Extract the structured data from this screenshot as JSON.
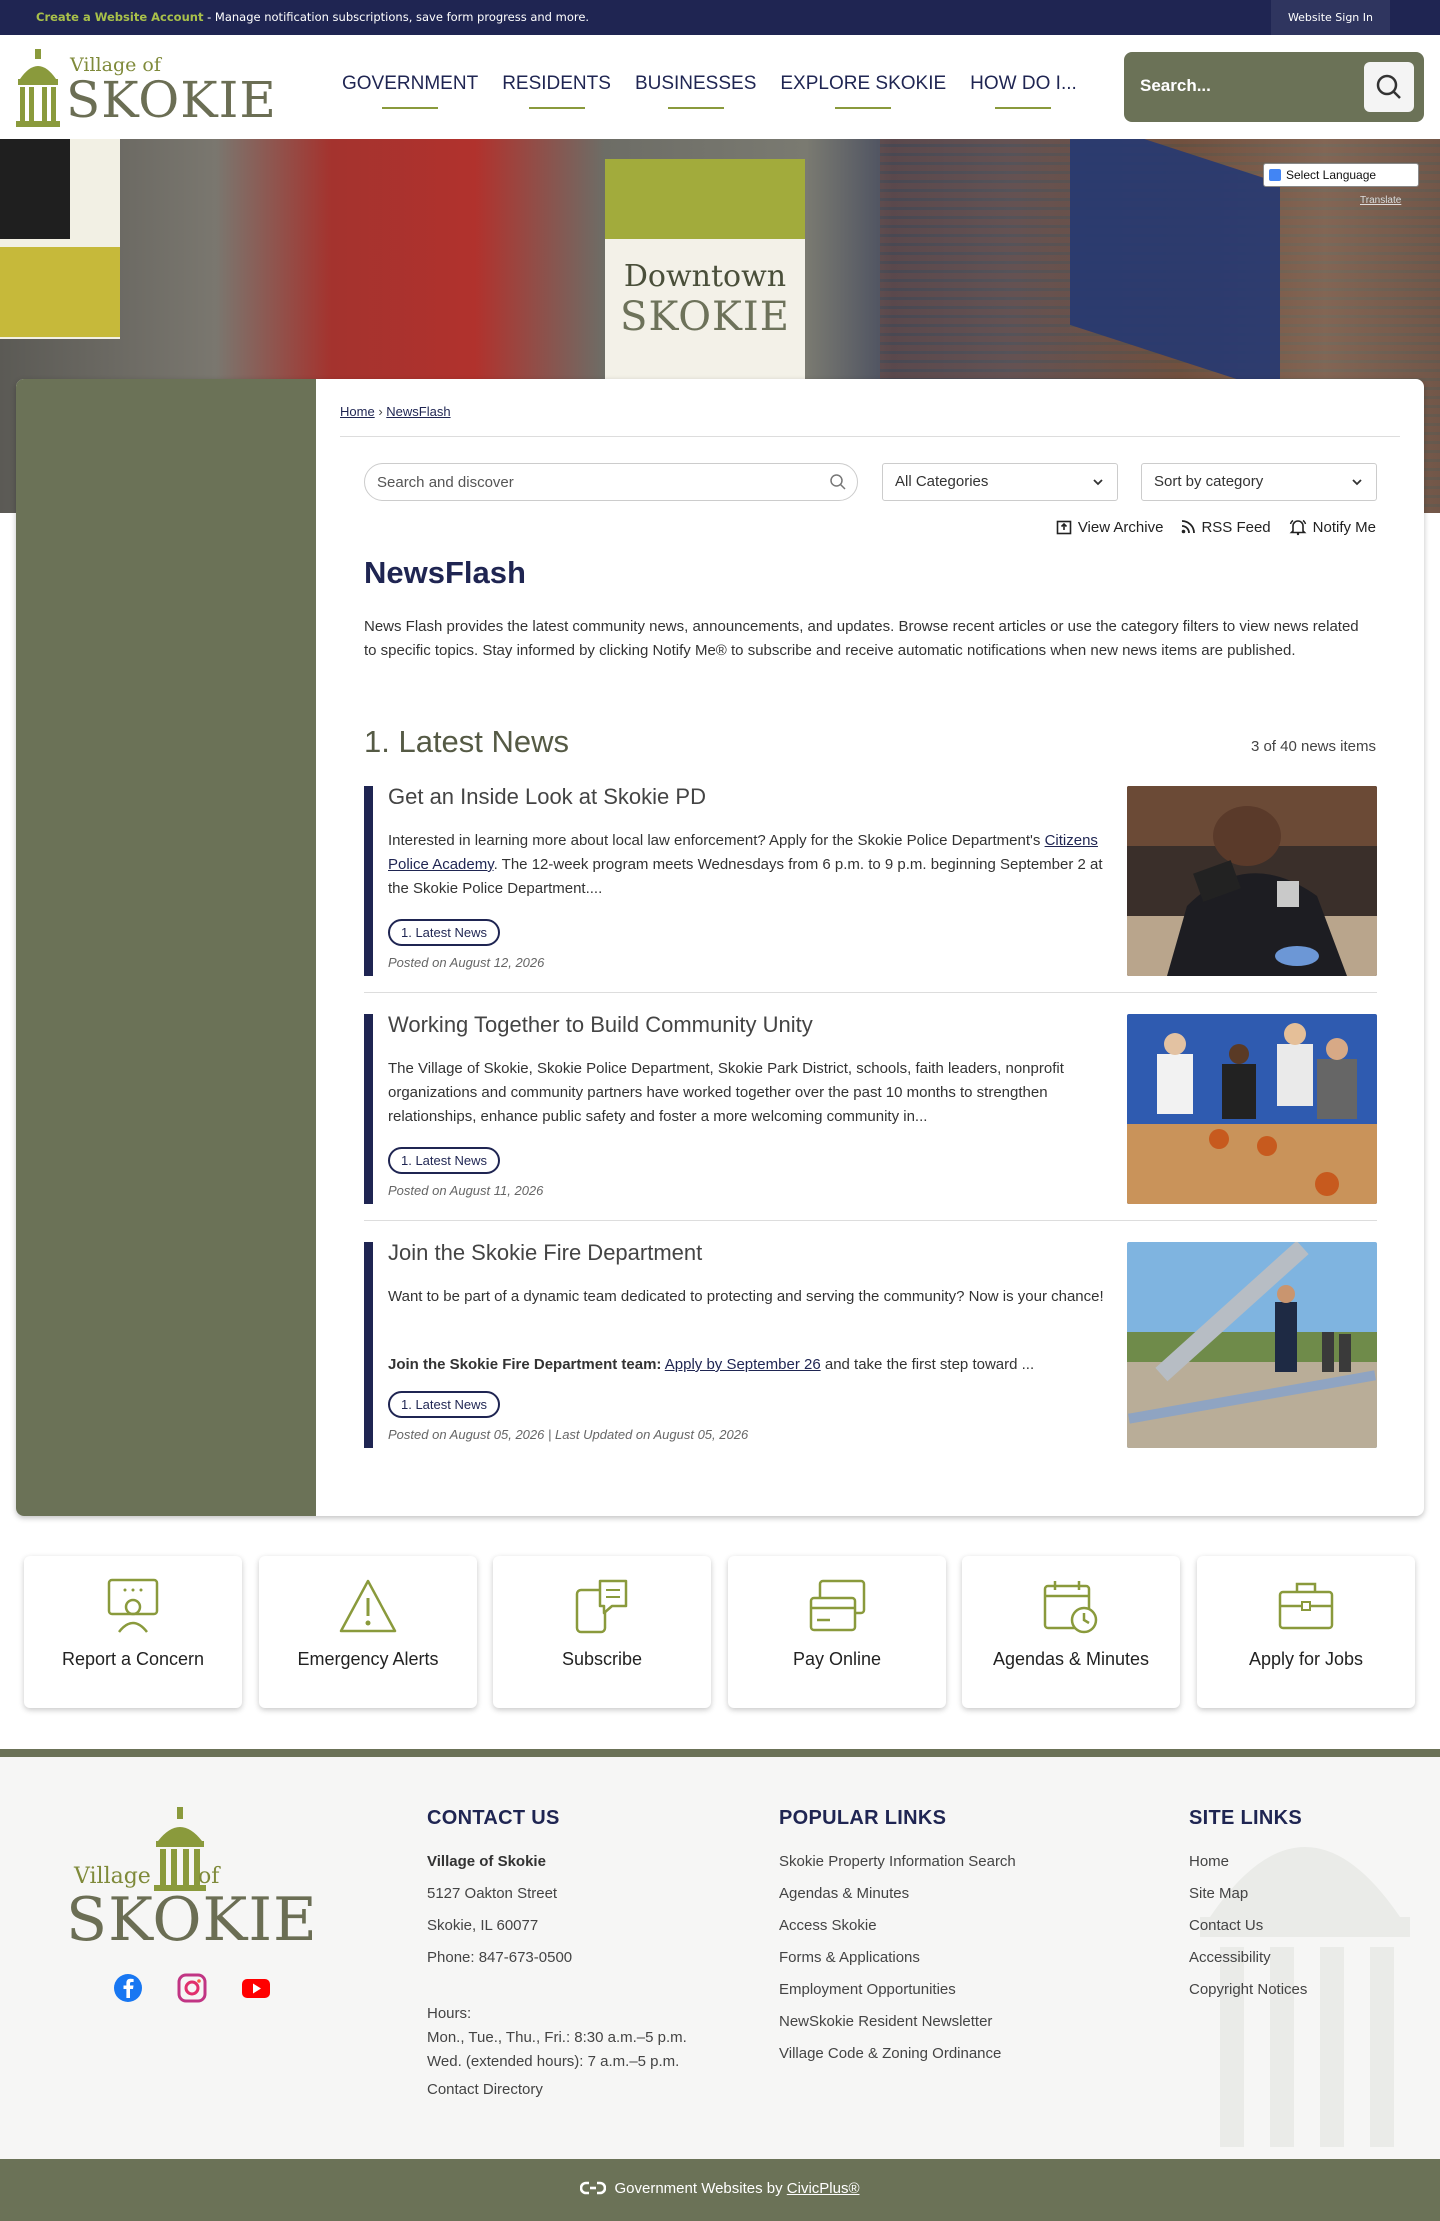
{
  "topbar": {
    "create_account": "Create a Website Account",
    "message": " - Manage notification subscriptions, save form progress and more.",
    "signin": "Website Sign In"
  },
  "header": {
    "logo_village_of": "Village of",
    "logo_name": "SKOKIE",
    "nav": [
      "GOVERNMENT",
      "RESIDENTS",
      "BUSINESSES",
      "EXPLORE SKOKIE",
      "HOW DO I..."
    ],
    "search_placeholder": "Search..."
  },
  "hero": {
    "flag_line1": "Downtown",
    "flag_line2": "SKOKIE",
    "language_select": "Select Language",
    "translate_link": "Translate"
  },
  "breadcrumb": {
    "home": "Home",
    "separator": "›",
    "current": "NewsFlash"
  },
  "filters": {
    "search_placeholder": "Search and discover",
    "category": "All Categories",
    "sort": "Sort by category"
  },
  "tools": {
    "archive": "View Archive",
    "rss": "RSS Feed",
    "notify": "Notify Me"
  },
  "page": {
    "title": "NewsFlash",
    "intro": "News Flash provides the latest community news, announcements, and updates. Browse recent articles or use the category filters to view news related to specific topics. Stay informed by clicking Notify Me® to subscribe and receive automatic notifications when new news items are published."
  },
  "section": {
    "title": "1. Latest News",
    "count": "3 of 40 news items"
  },
  "news": [
    {
      "title": "Get an Inside Look at Skokie PD",
      "desc_before": "Interested in learning more about local law enforcement? Apply for the Skokie Police Department's ",
      "desc_link": "Citizens Police Academy",
      "desc_after": ". The 12-week program meets Wednesdays from 6 p.m. to 9 p.m. beginning September 2 at the Skokie Police Department....",
      "category": "1. Latest News",
      "date": "Posted on August 12, 2026"
    },
    {
      "title": "Working Together to Build Community Unity",
      "desc": "The Village of Skokie, Skokie Police Department, Skokie Park District, schools, faith leaders, nonprofit organizations and community partners have worked together over the past 10 months to strengthen relationships, enhance public safety and foster a more welcoming community in...",
      "category": "1. Latest News",
      "date": "Posted on August 11, 2026"
    },
    {
      "title": "Join the Skokie Fire Department",
      "desc": "Want to be part of a dynamic team dedicated to protecting and serving the community? Now is your chance!",
      "desc2_bold": "Join the Skokie Fire Department team:",
      "desc2_link": "Apply by September 26",
      "desc2_after": " and take the first step toward ...",
      "category": "1. Latest News",
      "date": "Posted on August 05, 2026 | Last Updated on August 05, 2026"
    }
  ],
  "quick_links": [
    "Report a Concern",
    "Emergency Alerts",
    "Subscribe",
    "Pay Online",
    "Agendas & Minutes",
    "Apply for Jobs"
  ],
  "footer": {
    "logo_village": "Village",
    "logo_of": "of",
    "logo_name": "SKOKIE",
    "contact": {
      "heading": "CONTACT US",
      "org": "Village of Skokie",
      "street": "5127 Oakton Street",
      "city": "Skokie, IL 60077",
      "phone": "Phone: 847-673-0500",
      "hours_label": "Hours:",
      "hours1": "Mon., Tue., Thu., Fri.: 8:30 a.m.–5 p.m.",
      "hours2": "Wed. (extended hours): 7 a.m.–5 p.m.",
      "directory": "Contact Directory"
    },
    "popular": {
      "heading": "POPULAR LINKS",
      "links": [
        "Skokie Property Information Search",
        "Agendas & Minutes",
        "Access Skokie",
        "Forms & Applications",
        "Employment Opportunities",
        "NewSkokie Resident Newsletter",
        "Village Code & Zoning Ordinance"
      ]
    },
    "site": {
      "heading": "SITE LINKS",
      "links": [
        "Home",
        "Site Map",
        "Contact Us",
        "Accessibility",
        "Copyright Notices"
      ]
    },
    "bottom_prefix": "Government Websites by ",
    "bottom_link": "CivicPlus®"
  },
  "colors": {
    "navy": "#1f2552",
    "olive": "#6b7257",
    "green_accent": "#8a9a3c"
  }
}
